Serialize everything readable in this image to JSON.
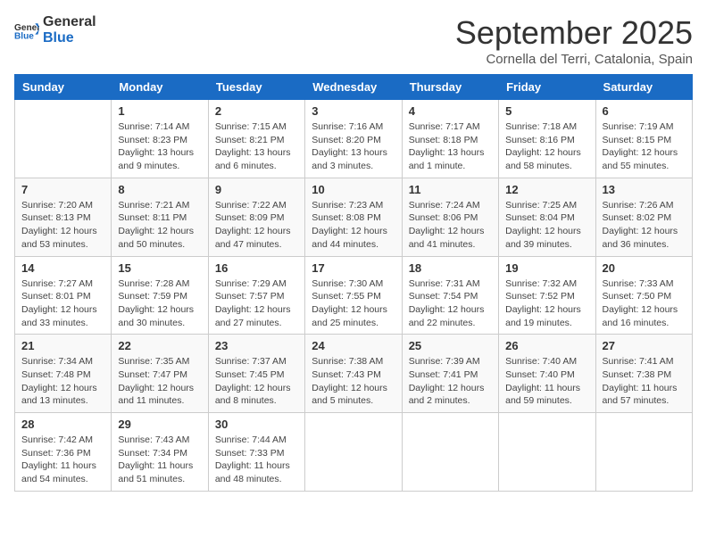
{
  "logo": {
    "general": "General",
    "blue": "Blue"
  },
  "header": {
    "month": "September 2025",
    "location": "Cornella del Terri, Catalonia, Spain"
  },
  "days_of_week": [
    "Sunday",
    "Monday",
    "Tuesday",
    "Wednesday",
    "Thursday",
    "Friday",
    "Saturday"
  ],
  "weeks": [
    [
      {
        "day": "",
        "info": ""
      },
      {
        "day": "1",
        "info": "Sunrise: 7:14 AM\nSunset: 8:23 PM\nDaylight: 13 hours\nand 9 minutes."
      },
      {
        "day": "2",
        "info": "Sunrise: 7:15 AM\nSunset: 8:21 PM\nDaylight: 13 hours\nand 6 minutes."
      },
      {
        "day": "3",
        "info": "Sunrise: 7:16 AM\nSunset: 8:20 PM\nDaylight: 13 hours\nand 3 minutes."
      },
      {
        "day": "4",
        "info": "Sunrise: 7:17 AM\nSunset: 8:18 PM\nDaylight: 13 hours\nand 1 minute."
      },
      {
        "day": "5",
        "info": "Sunrise: 7:18 AM\nSunset: 8:16 PM\nDaylight: 12 hours\nand 58 minutes."
      },
      {
        "day": "6",
        "info": "Sunrise: 7:19 AM\nSunset: 8:15 PM\nDaylight: 12 hours\nand 55 minutes."
      }
    ],
    [
      {
        "day": "7",
        "info": "Sunrise: 7:20 AM\nSunset: 8:13 PM\nDaylight: 12 hours\nand 53 minutes."
      },
      {
        "day": "8",
        "info": "Sunrise: 7:21 AM\nSunset: 8:11 PM\nDaylight: 12 hours\nand 50 minutes."
      },
      {
        "day": "9",
        "info": "Sunrise: 7:22 AM\nSunset: 8:09 PM\nDaylight: 12 hours\nand 47 minutes."
      },
      {
        "day": "10",
        "info": "Sunrise: 7:23 AM\nSunset: 8:08 PM\nDaylight: 12 hours\nand 44 minutes."
      },
      {
        "day": "11",
        "info": "Sunrise: 7:24 AM\nSunset: 8:06 PM\nDaylight: 12 hours\nand 41 minutes."
      },
      {
        "day": "12",
        "info": "Sunrise: 7:25 AM\nSunset: 8:04 PM\nDaylight: 12 hours\nand 39 minutes."
      },
      {
        "day": "13",
        "info": "Sunrise: 7:26 AM\nSunset: 8:02 PM\nDaylight: 12 hours\nand 36 minutes."
      }
    ],
    [
      {
        "day": "14",
        "info": "Sunrise: 7:27 AM\nSunset: 8:01 PM\nDaylight: 12 hours\nand 33 minutes."
      },
      {
        "day": "15",
        "info": "Sunrise: 7:28 AM\nSunset: 7:59 PM\nDaylight: 12 hours\nand 30 minutes."
      },
      {
        "day": "16",
        "info": "Sunrise: 7:29 AM\nSunset: 7:57 PM\nDaylight: 12 hours\nand 27 minutes."
      },
      {
        "day": "17",
        "info": "Sunrise: 7:30 AM\nSunset: 7:55 PM\nDaylight: 12 hours\nand 25 minutes."
      },
      {
        "day": "18",
        "info": "Sunrise: 7:31 AM\nSunset: 7:54 PM\nDaylight: 12 hours\nand 22 minutes."
      },
      {
        "day": "19",
        "info": "Sunrise: 7:32 AM\nSunset: 7:52 PM\nDaylight: 12 hours\nand 19 minutes."
      },
      {
        "day": "20",
        "info": "Sunrise: 7:33 AM\nSunset: 7:50 PM\nDaylight: 12 hours\nand 16 minutes."
      }
    ],
    [
      {
        "day": "21",
        "info": "Sunrise: 7:34 AM\nSunset: 7:48 PM\nDaylight: 12 hours\nand 13 minutes."
      },
      {
        "day": "22",
        "info": "Sunrise: 7:35 AM\nSunset: 7:47 PM\nDaylight: 12 hours\nand 11 minutes."
      },
      {
        "day": "23",
        "info": "Sunrise: 7:37 AM\nSunset: 7:45 PM\nDaylight: 12 hours\nand 8 minutes."
      },
      {
        "day": "24",
        "info": "Sunrise: 7:38 AM\nSunset: 7:43 PM\nDaylight: 12 hours\nand 5 minutes."
      },
      {
        "day": "25",
        "info": "Sunrise: 7:39 AM\nSunset: 7:41 PM\nDaylight: 12 hours\nand 2 minutes."
      },
      {
        "day": "26",
        "info": "Sunrise: 7:40 AM\nSunset: 7:40 PM\nDaylight: 11 hours\nand 59 minutes."
      },
      {
        "day": "27",
        "info": "Sunrise: 7:41 AM\nSunset: 7:38 PM\nDaylight: 11 hours\nand 57 minutes."
      }
    ],
    [
      {
        "day": "28",
        "info": "Sunrise: 7:42 AM\nSunset: 7:36 PM\nDaylight: 11 hours\nand 54 minutes."
      },
      {
        "day": "29",
        "info": "Sunrise: 7:43 AM\nSunset: 7:34 PM\nDaylight: 11 hours\nand 51 minutes."
      },
      {
        "day": "30",
        "info": "Sunrise: 7:44 AM\nSunset: 7:33 PM\nDaylight: 11 hours\nand 48 minutes."
      },
      {
        "day": "",
        "info": ""
      },
      {
        "day": "",
        "info": ""
      },
      {
        "day": "",
        "info": ""
      },
      {
        "day": "",
        "info": ""
      }
    ]
  ]
}
